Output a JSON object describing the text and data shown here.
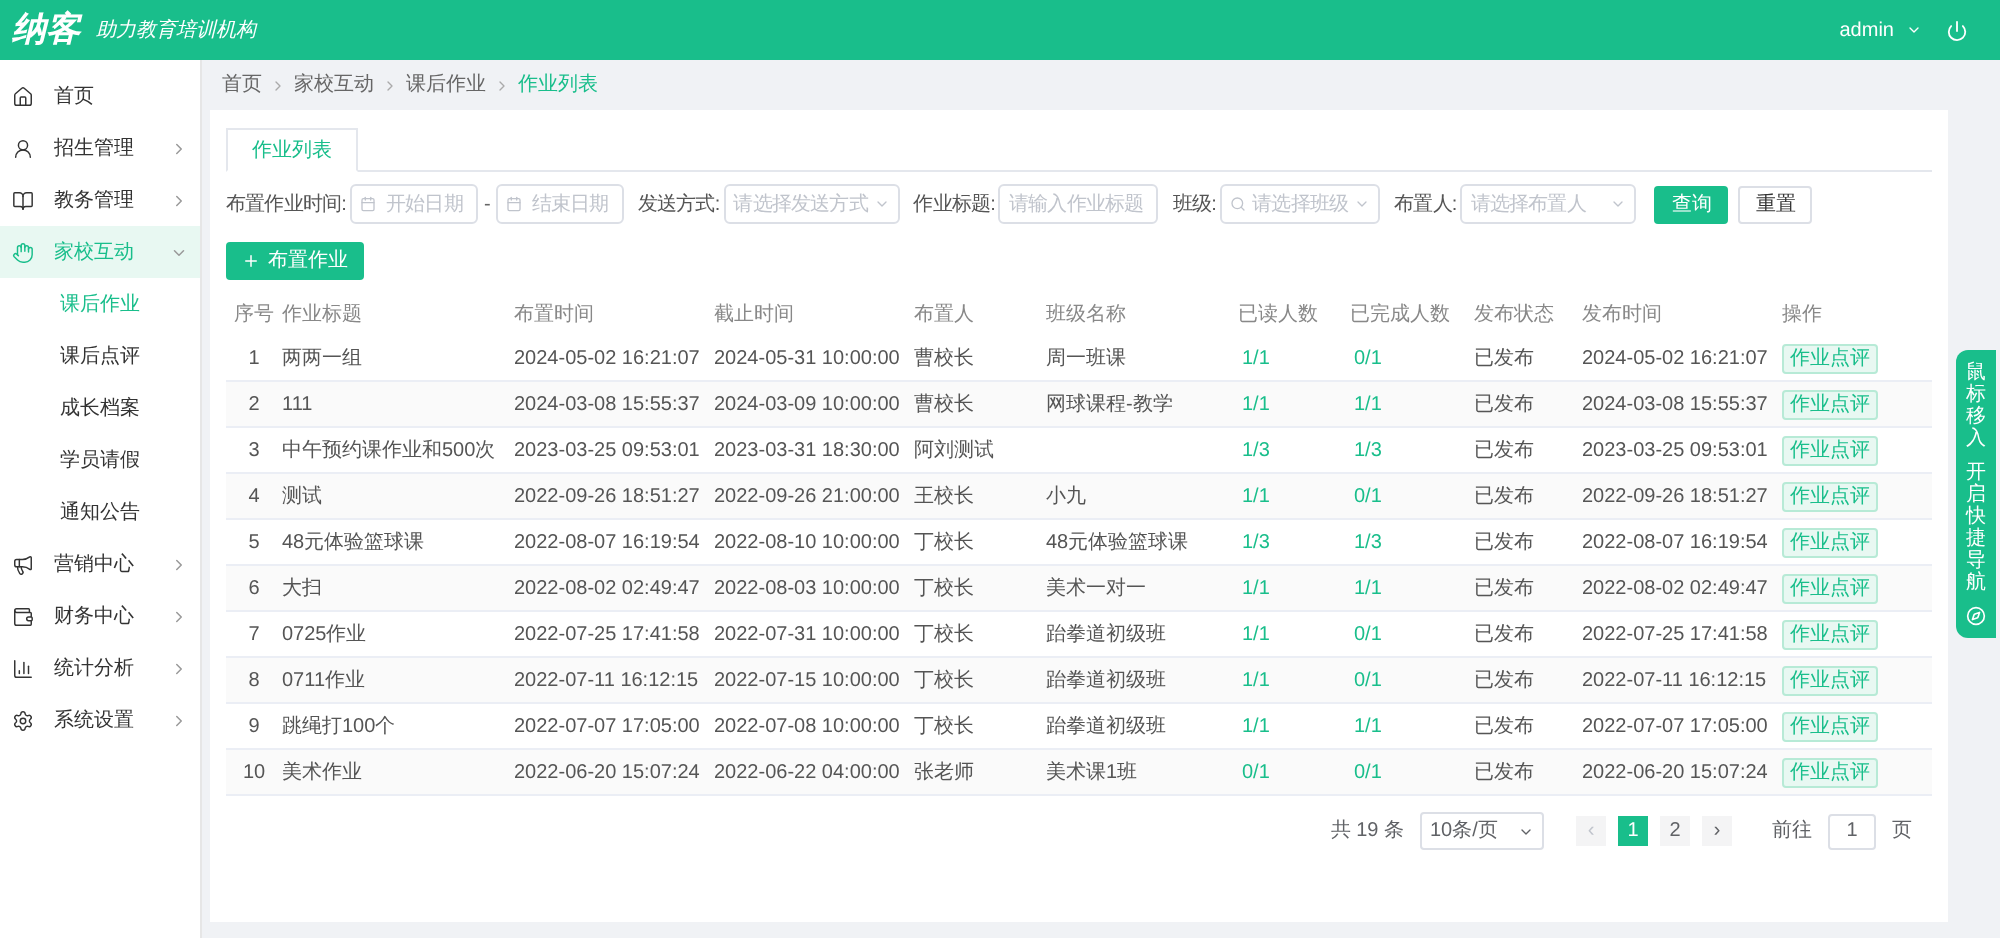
{
  "header": {
    "logo": "纳客",
    "slogan": "助力教育培训机构",
    "user": "admin"
  },
  "sidebar": {
    "items": [
      {
        "label": "首页",
        "selected": false
      },
      {
        "label": "招生管理",
        "selected": false,
        "expanded": false
      },
      {
        "label": "教务管理",
        "selected": false,
        "expanded": false
      },
      {
        "label": "家校互动",
        "selected": true,
        "expanded": true,
        "children": [
          {
            "label": "课后作业",
            "selected": true
          },
          {
            "label": "课后点评",
            "selected": false
          },
          {
            "label": "成长档案",
            "selected": false
          },
          {
            "label": "学员请假",
            "selected": false
          },
          {
            "label": "通知公告",
            "selected": false
          }
        ]
      },
      {
        "label": "营销中心",
        "selected": false,
        "expanded": false
      },
      {
        "label": "财务中心",
        "selected": false,
        "expanded": false
      },
      {
        "label": "统计分析",
        "selected": false,
        "expanded": false
      },
      {
        "label": "系统设置",
        "selected": false,
        "expanded": false
      }
    ]
  },
  "breadcrumb": [
    "首页",
    "家校互动",
    "课后作业",
    "作业列表"
  ],
  "tabs": [
    {
      "label": "作业列表",
      "selected": true
    }
  ],
  "filters": [
    {
      "kind": "daterange",
      "label": "布置作业时间:",
      "start": "开始日期",
      "separator": "-",
      "end": "结束日期"
    },
    {
      "kind": "select",
      "label": "发送方式:",
      "placeholder": "请选择发送方式"
    },
    {
      "kind": "input",
      "label": "作业标题:",
      "placeholder": "请输入作业标题"
    },
    {
      "kind": "search-select",
      "label": "班级:",
      "placeholder": "请选择班级"
    },
    {
      "kind": "select",
      "label": "布置人:",
      "placeholder": "请选择布置人"
    }
  ],
  "buttons": {
    "query": "查询",
    "reset": "重置",
    "add": "布置作业"
  },
  "table": {
    "columns": [
      "序号",
      "作业标题",
      "布置时间",
      "截止时间",
      "布置人",
      "班级名称",
      "已读人数",
      "已完成人数",
      "发布状态",
      "发布时间",
      "操作"
    ],
    "rows": [
      [
        "1",
        "两两一组",
        "2024-05-02 16:21:07",
        "2024-05-31 10:00:00",
        "曹校长",
        "周一班课",
        "1/1",
        "0/1",
        "已发布",
        "2024-05-02 16:21:07",
        "作业点评"
      ],
      [
        "2",
        "111",
        "2024-03-08 15:55:37",
        "2024-03-09 10:00:00",
        "曹校长",
        "网球课程-教学",
        "1/1",
        "1/1",
        "已发布",
        "2024-03-08 15:55:37",
        "作业点评"
      ],
      [
        "3",
        "中午预约课作业和500次",
        "2023-03-25 09:53:01",
        "2023-03-31 18:30:00",
        "阿刘测试",
        "",
        "1/3",
        "1/3",
        "已发布",
        "2023-03-25 09:53:01",
        "作业点评"
      ],
      [
        "4",
        "测试",
        "2022-09-26 18:51:27",
        "2022-09-26 21:00:00",
        "王校长",
        "小九",
        "1/1",
        "0/1",
        "已发布",
        "2022-09-26 18:51:27",
        "作业点评"
      ],
      [
        "5",
        "48元体验篮球课",
        "2022-08-07 16:19:54",
        "2022-08-10 10:00:00",
        "丁校长",
        "48元体验篮球课",
        "1/3",
        "1/3",
        "已发布",
        "2022-08-07 16:19:54",
        "作业点评"
      ],
      [
        "6",
        "大扫",
        "2022-08-02 02:49:47",
        "2022-08-03 10:00:00",
        "丁校长",
        "美术一对一",
        "1/1",
        "1/1",
        "已发布",
        "2022-08-02 02:49:47",
        "作业点评"
      ],
      [
        "7",
        "0725作业",
        "2022-07-25 17:41:58",
        "2022-07-31 10:00:00",
        "丁校长",
        "跆拳道初级班",
        "1/1",
        "0/1",
        "已发布",
        "2022-07-25 17:41:58",
        "作业点评"
      ],
      [
        "8",
        "0711作业",
        "2022-07-11 16:12:15",
        "2022-07-15 10:00:00",
        "丁校长",
        "跆拳道初级班",
        "1/1",
        "0/1",
        "已发布",
        "2022-07-11 16:12:15",
        "作业点评"
      ],
      [
        "9",
        "跳绳打100个",
        "2022-07-07 17:05:00",
        "2022-07-08 10:00:00",
        "丁校长",
        "跆拳道初级班",
        "1/1",
        "1/1",
        "已发布",
        "2022-07-07 17:05:00",
        "作业点评"
      ],
      [
        "10",
        "美术作业",
        "2022-06-20 15:07:24",
        "2022-06-22 04:00:00",
        "张老师",
        "美术课1班",
        "0/1",
        "0/1",
        "已发布",
        "2022-06-20 15:07:24",
        "作业点评"
      ]
    ]
  },
  "pagination": {
    "total": "共 19 条",
    "page_size": "10条/页",
    "prev": "‹",
    "next": "›",
    "pages": [
      {
        "label": "1",
        "selected": true
      },
      {
        "label": "2",
        "selected": false
      }
    ],
    "goto_label": "前往",
    "goto_value": "1",
    "goto_unit": "页"
  },
  "quick_nav": {
    "lines": [
      "鼠标移入",
      "开启快捷导航"
    ]
  }
}
